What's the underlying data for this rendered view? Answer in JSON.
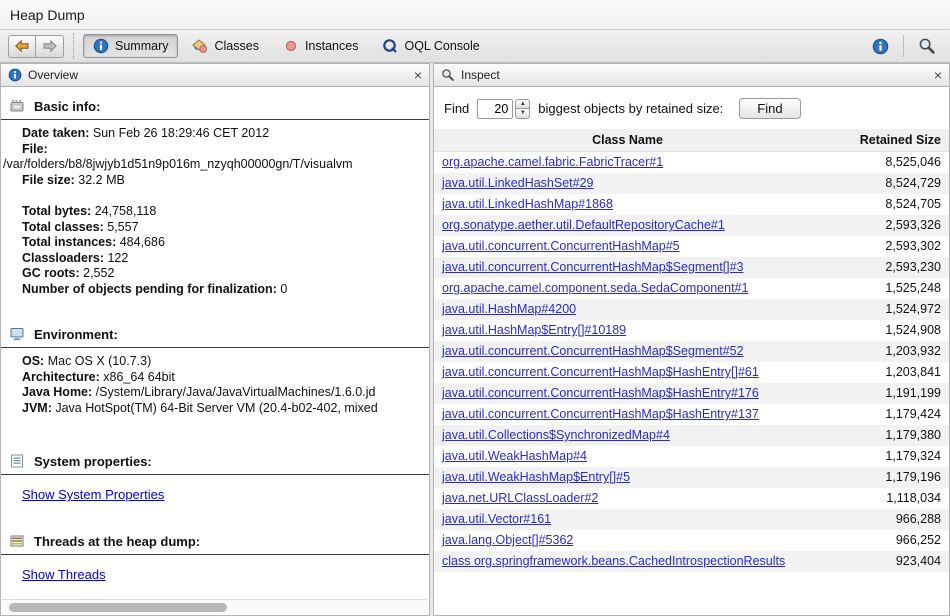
{
  "window": {
    "title": "Heap Dump"
  },
  "toolbar": {
    "views": [
      {
        "label": "Summary"
      },
      {
        "label": "Classes"
      },
      {
        "label": "Instances"
      },
      {
        "label": "OQL Console"
      }
    ]
  },
  "overview": {
    "title": "Overview",
    "basic_info": {
      "heading": "Basic info:",
      "date_taken": {
        "label": "Date taken:",
        "value": "Sun Feb 26 18:29:46 CET 2012"
      },
      "file_label": "File:",
      "file_path": "/var/folders/b8/8jwjyb1d51n9p016m_nzyqh00000gn/T/visualvm",
      "file_size": {
        "label": "File size:",
        "value": "32.2 MB"
      },
      "totals": [
        {
          "label": "Total bytes:",
          "value": "24,758,118"
        },
        {
          "label": "Total classes:",
          "value": "5,557"
        },
        {
          "label": "Total instances:",
          "value": "484,686"
        },
        {
          "label": "Classloaders:",
          "value": "122"
        },
        {
          "label": "GC roots:",
          "value": "2,552"
        },
        {
          "label": "Number of objects pending for finalization:",
          "value": "0"
        }
      ]
    },
    "environment": {
      "heading": "Environment:",
      "lines": [
        {
          "label": "OS:",
          "value": "Mac OS X (10.7.3)"
        },
        {
          "label": "Architecture:",
          "value": "x86_64 64bit"
        },
        {
          "label": "Java Home:",
          "value": "/System/Library/Java/JavaVirtualMachines/1.6.0.jd"
        },
        {
          "label": "JVM:",
          "value": "Java HotSpot(TM) 64-Bit Server VM (20.4-b02-402, mixed"
        }
      ]
    },
    "system_properties": {
      "heading": "System properties:",
      "link": "Show System Properties"
    },
    "threads": {
      "heading": "Threads at the heap dump:",
      "link": "Show Threads"
    }
  },
  "inspect": {
    "title": "Inspect",
    "find": {
      "label": "Find",
      "count": "20",
      "caption": "biggest objects by retained size:",
      "button": "Find"
    },
    "table": {
      "columns": [
        "Class Name",
        "Retained Size"
      ],
      "rows": [
        {
          "class_name": "org.apache.camel.fabric.FabricTracer#1",
          "retained_size": "8,525,046"
        },
        {
          "class_name": "java.util.LinkedHashSet#29",
          "retained_size": "8,524,729"
        },
        {
          "class_name": "java.util.LinkedHashMap#1868",
          "retained_size": "8,524,705"
        },
        {
          "class_name": "org.sonatype.aether.util.DefaultRepositoryCache#1",
          "retained_size": "2,593,326"
        },
        {
          "class_name": "java.util.concurrent.ConcurrentHashMap#5",
          "retained_size": "2,593,302"
        },
        {
          "class_name": "java.util.concurrent.ConcurrentHashMap$Segment[]#3",
          "retained_size": "2,593,230"
        },
        {
          "class_name": "org.apache.camel.component.seda.SedaComponent#1",
          "retained_size": "1,525,248"
        },
        {
          "class_name": "java.util.HashMap#4200",
          "retained_size": "1,524,972"
        },
        {
          "class_name": "java.util.HashMap$Entry[]#10189",
          "retained_size": "1,524,908"
        },
        {
          "class_name": "java.util.concurrent.ConcurrentHashMap$Segment#52",
          "retained_size": "1,203,932"
        },
        {
          "class_name": "java.util.concurrent.ConcurrentHashMap$HashEntry[]#61",
          "retained_size": "1,203,841"
        },
        {
          "class_name": "java.util.concurrent.ConcurrentHashMap$HashEntry#176",
          "retained_size": "1,191,199"
        },
        {
          "class_name": "java.util.concurrent.ConcurrentHashMap$HashEntry#137",
          "retained_size": "1,179,424"
        },
        {
          "class_name": "java.util.Collections$SynchronizedMap#4",
          "retained_size": "1,179,380"
        },
        {
          "class_name": "java.util.WeakHashMap#4",
          "retained_size": "1,179,324"
        },
        {
          "class_name": "java.util.WeakHashMap$Entry[]#5",
          "retained_size": "1,179,196"
        },
        {
          "class_name": "java.net.URLClassLoader#2",
          "retained_size": "1,118,034"
        },
        {
          "class_name": "java.util.Vector#161",
          "retained_size": "966,288"
        },
        {
          "class_name": "java.lang.Object[]#5362",
          "retained_size": "966,252"
        },
        {
          "class_name": "class org.springframework.beans.CachedIntrospectionResults",
          "retained_size": "923,404"
        }
      ]
    }
  },
  "colors": {
    "table_link": "#2929d6",
    "overview_link": "#0000e8",
    "row_stripe": "#f2f2f2",
    "info_icon_blue": "#2f74c0",
    "back_arrow_gold": "#e0a33a"
  }
}
